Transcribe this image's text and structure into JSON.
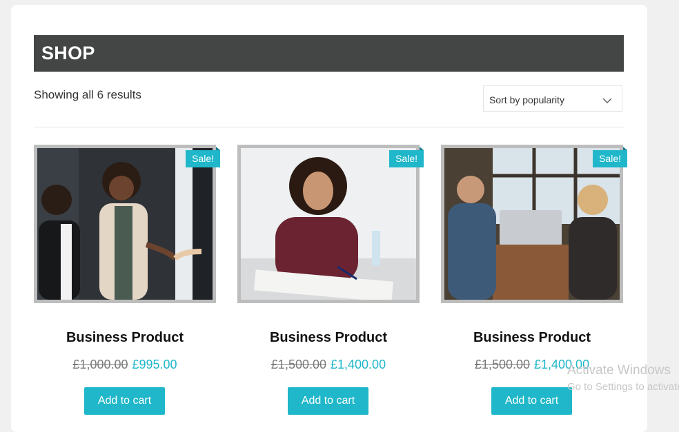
{
  "shop": {
    "title": "SHOP"
  },
  "results_text": "Showing all 6 results",
  "sort": {
    "selected": "Sort by popularity",
    "icon": "chevron-down-icon"
  },
  "colors": {
    "accent": "#1fb7c9",
    "header_bg": "#444646"
  },
  "products": [
    {
      "badge": "Sale!",
      "name": "Business Product",
      "old_price": "£1,000.00",
      "price": "£995.00",
      "button": "Add to cart"
    },
    {
      "badge": "Sale!",
      "name": "Business Product",
      "old_price": "£1,500.00",
      "price": "£1,400.00",
      "button": "Add to cart"
    },
    {
      "badge": "Sale!",
      "name": "Business Product",
      "old_price": "£1,500.00",
      "price": "£1,400.00",
      "button": "Add to cart"
    }
  ],
  "watermark": {
    "line1": "Activate Windows",
    "line2": "Go to Settings to activate"
  }
}
